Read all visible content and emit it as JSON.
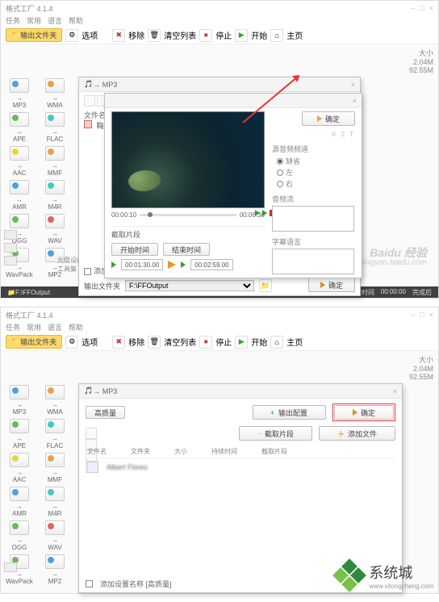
{
  "app": {
    "title": "格式工厂 4.1.4",
    "menus": [
      "任务",
      "常用",
      "语言",
      "帮助"
    ]
  },
  "toolbar": {
    "output_folder": "输出文件夹",
    "options": "选项",
    "remove": "移除",
    "clear": "清空列表",
    "stop": "停止",
    "start": "开始",
    "home": "主页"
  },
  "rightcol": {
    "hdr": "大小",
    "v1": "2.04M",
    "v2": "92.55M"
  },
  "formats": [
    "MP3",
    "WMA",
    "APE",
    "FLAC",
    "AAC",
    "MMF",
    "AMR",
    "M4R",
    "OGG",
    "WAV",
    "WavPack",
    "MP2"
  ],
  "lowlabels": {
    "dvd": "光盘设备\\DVD\\CD\\ISO",
    "tool": "工具集"
  },
  "footer": {
    "output_prefix": "输出文件夹",
    "output": "F:\\FFOutput",
    "elapsed": "已用时间",
    "time": "00:00:00",
    "after": "完成后"
  },
  "dialog1": {
    "title": "→ MP3",
    "filename_lbl": "文件名",
    "filename_val": "鞠工画",
    "ok": "确定",
    "output_lbl": "输出文件夹",
    "output_val": "F:\\FFOutput"
  },
  "dialog1b": {
    "ok": "确定",
    "hint": "X 2 T",
    "group_src": "源音频频道",
    "opt1": "缺省",
    "opt2": "左",
    "opt3": "右",
    "audio_lbl": "音频流",
    "sub_lbl": "字幕语言",
    "time_l": "00:00:10",
    "time_r": "00:06:30",
    "clip_lbl": "截取片段",
    "start_btn": "开始时间",
    "end_btn": "结束时间",
    "start_t": "00:01:30.00",
    "end_t": "00:02:59.00",
    "addmeta": "添加设置名称 [高质量]"
  },
  "dialog2": {
    "title": "→ MP3",
    "hq": "高质量",
    "outcfg": "输出配置",
    "ok": "确定",
    "clip": "截取片段",
    "addfile": "添加文件",
    "cols": [
      "文件名",
      "文件夹",
      "大小",
      "持续时间",
      "截取片段"
    ],
    "row": {
      "name": "Albert Flores",
      "folder": "—",
      "size": "—",
      "dur": "—",
      "clip": "—"
    },
    "addmeta": "添加设置名称 [高质量]"
  },
  "watermark": {
    "big": "Baidu 经验",
    "small": "jingyan.baidu.com"
  },
  "logo": {
    "txt": "系统城",
    "sub": "www.xitongcheng.com"
  }
}
